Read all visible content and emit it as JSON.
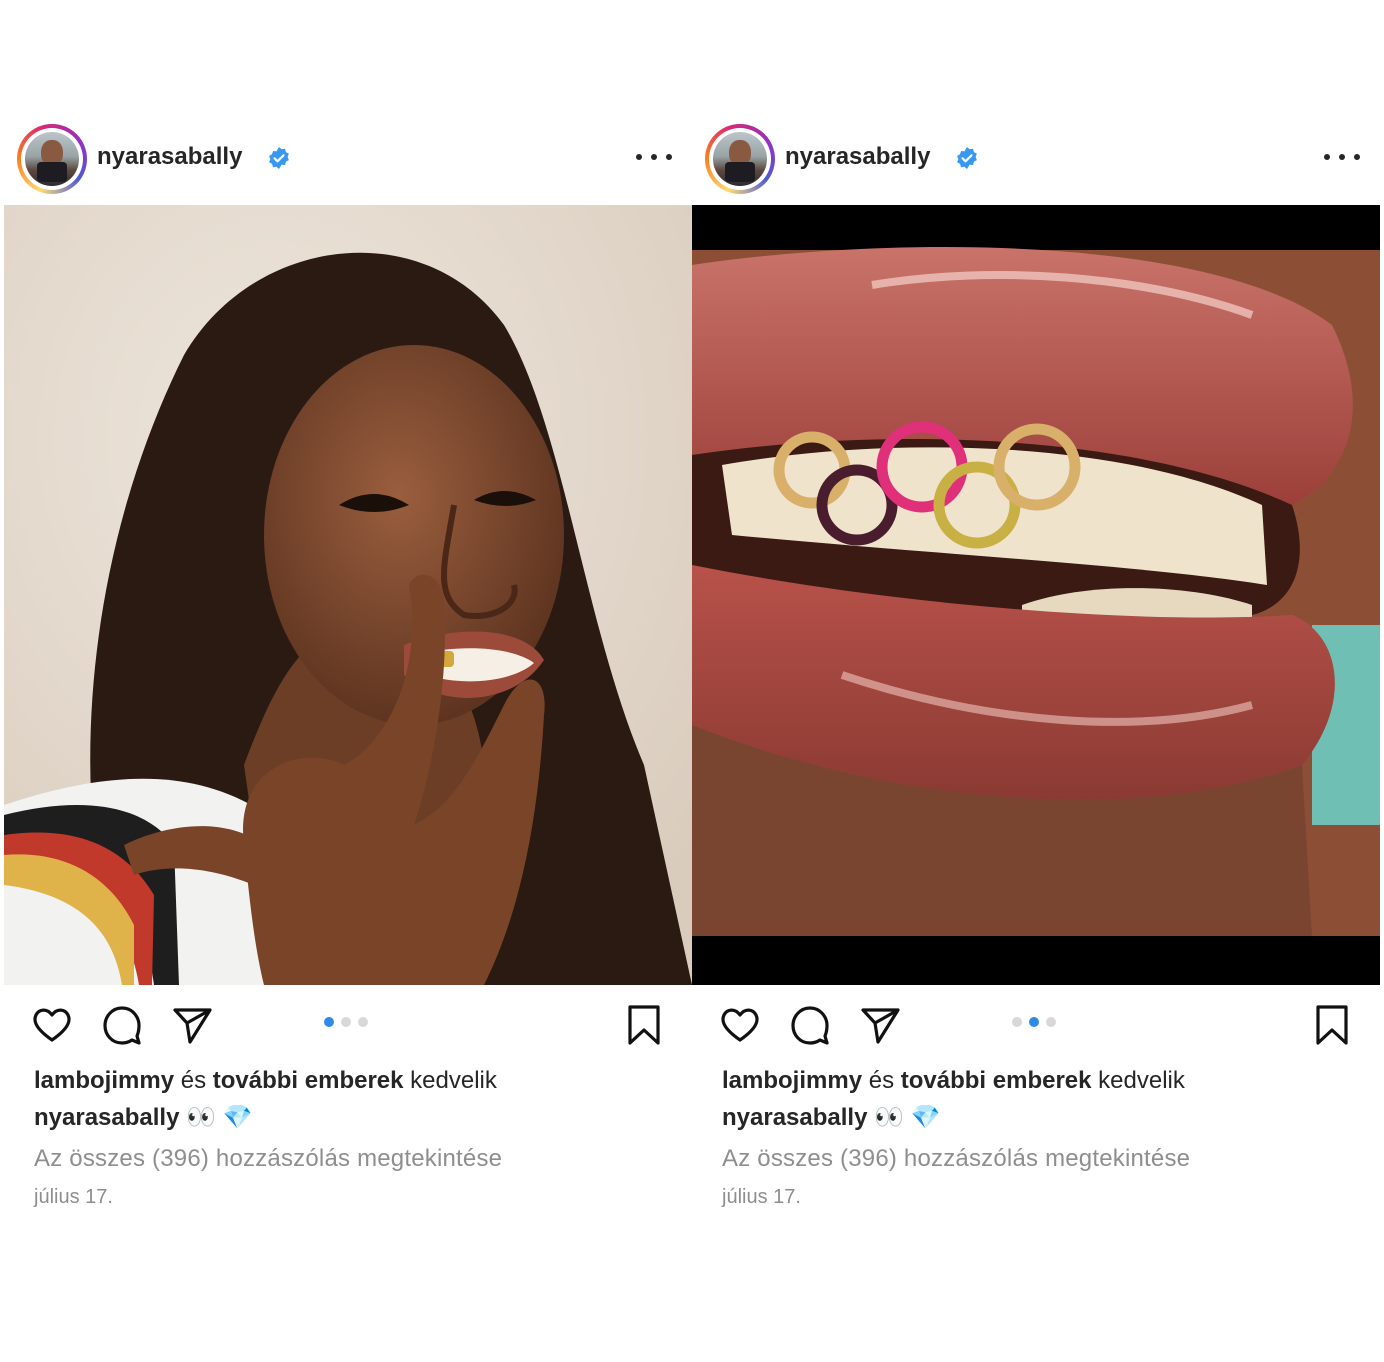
{
  "posts": [
    {
      "username": "nyarasabally",
      "liked_by": "lambojimmy",
      "and_text": "és",
      "others_text": "további emberek",
      "likes_suffix": "kedvelik",
      "caption_user": "nyarasabally",
      "caption_text": "👀 💎",
      "comments_link": "Az összes (396) hozzászólás megtekintése",
      "date": "július 17.",
      "carousel": {
        "total": 3,
        "active_index": 1
      }
    },
    {
      "username": "nyarasabally",
      "liked_by": "lambojimmy",
      "and_text": "és",
      "others_text": "további emberek",
      "likes_suffix": "kedvelik",
      "caption_user": "nyarasabally",
      "caption_text": "👀 💎",
      "comments_link": "Az összes (396) hozzászólás megtekintése",
      "date": "július 17.",
      "carousel": {
        "total": 3,
        "active_index": 2
      }
    }
  ],
  "icons": {
    "verified": "verified-badge-icon",
    "more": "more-options-icon",
    "like": "heart-icon",
    "comment": "comment-bubble-icon",
    "share": "paper-plane-icon",
    "save": "bookmark-icon"
  },
  "colors": {
    "verified": "#3897f0",
    "carousel_active": "#2f8ae5",
    "carousel_inactive": "#d8d8d8",
    "muted_text": "#8e8e8e",
    "text": "#262626"
  }
}
